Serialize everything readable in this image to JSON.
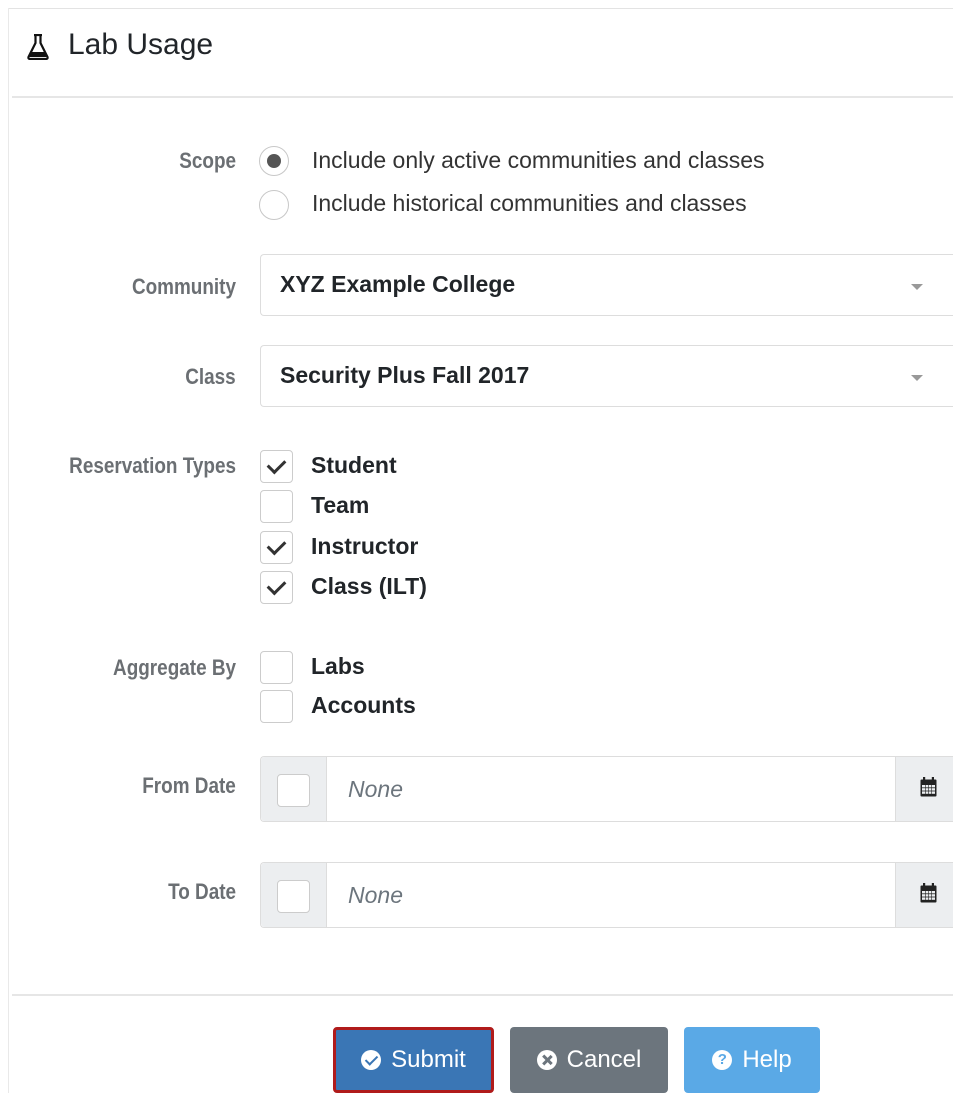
{
  "header": {
    "icon": "flask-icon",
    "title": "Lab Usage"
  },
  "form": {
    "scope": {
      "label": "Scope",
      "options": [
        {
          "text": "Include only active communities and classes",
          "selected": true
        },
        {
          "text": "Include historical communities and classes",
          "selected": false
        }
      ]
    },
    "community": {
      "label": "Community",
      "value": "XYZ Example College"
    },
    "class": {
      "label": "Class",
      "value": "Security Plus Fall 2017"
    },
    "reservation_types": {
      "label": "Reservation Types",
      "options": [
        {
          "text": "Student",
          "checked": true
        },
        {
          "text": "Team",
          "checked": false
        },
        {
          "text": "Instructor",
          "checked": true
        },
        {
          "text": "Class (ILT)",
          "checked": true
        }
      ]
    },
    "aggregate_by": {
      "label": "Aggregate By",
      "options": [
        {
          "text": "Labs",
          "checked": false
        },
        {
          "text": "Accounts",
          "checked": false
        }
      ]
    },
    "from_date": {
      "label": "From Date",
      "placeholder": "None",
      "enabled": false,
      "icon": "calendar-icon"
    },
    "to_date": {
      "label": "To Date",
      "placeholder": "None",
      "enabled": false,
      "icon": "calendar-icon"
    }
  },
  "actions": {
    "submit_label": "Submit",
    "cancel_label": "Cancel",
    "help_label": "Help"
  },
  "colors": {
    "submit": "#3a76b5",
    "submit_highlight_border": "#b01b1b",
    "cancel": "#6c757d",
    "help": "#5aa9e6",
    "label_gray": "#6b6f73"
  }
}
